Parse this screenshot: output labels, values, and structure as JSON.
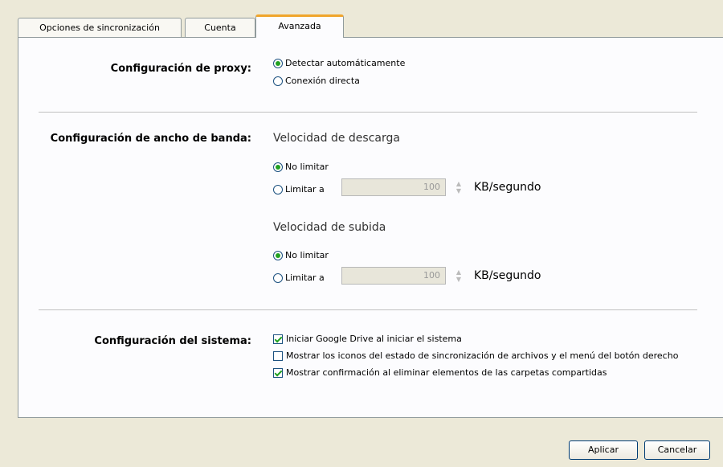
{
  "tabs": [
    {
      "label": "Opciones de sincronización"
    },
    {
      "label": "Cuenta"
    },
    {
      "label": "Avanzada"
    }
  ],
  "proxy": {
    "section_label": "Configuración de proxy:",
    "options": [
      {
        "label": "Detectar automáticamente",
        "selected": true
      },
      {
        "label": "Conexión directa",
        "selected": false
      }
    ]
  },
  "bandwidth": {
    "section_label": "Configuración de ancho de banda:",
    "download": {
      "heading": "Velocidad de descarga",
      "no_limit_label": "No limitar",
      "limit_label": "Limitar a",
      "selected": "no_limit",
      "value": "100",
      "unit": "KB/segundo"
    },
    "upload": {
      "heading": "Velocidad de subida",
      "no_limit_label": "No limitar",
      "limit_label": "Limitar a",
      "selected": "no_limit",
      "value": "100",
      "unit": "KB/segundo"
    }
  },
  "system": {
    "section_label": "Configuración del sistema:",
    "options": [
      {
        "label": "Iniciar Google Drive al iniciar el sistema",
        "checked": true
      },
      {
        "label": "Mostrar los iconos del estado de sincronización de archivos y el menú del botón derecho",
        "checked": false
      },
      {
        "label": "Mostrar confirmación al eliminar elementos de las carpetas compartidas",
        "checked": true
      }
    ]
  },
  "buttons": {
    "apply": "Aplicar",
    "cancel": "Cancelar"
  }
}
